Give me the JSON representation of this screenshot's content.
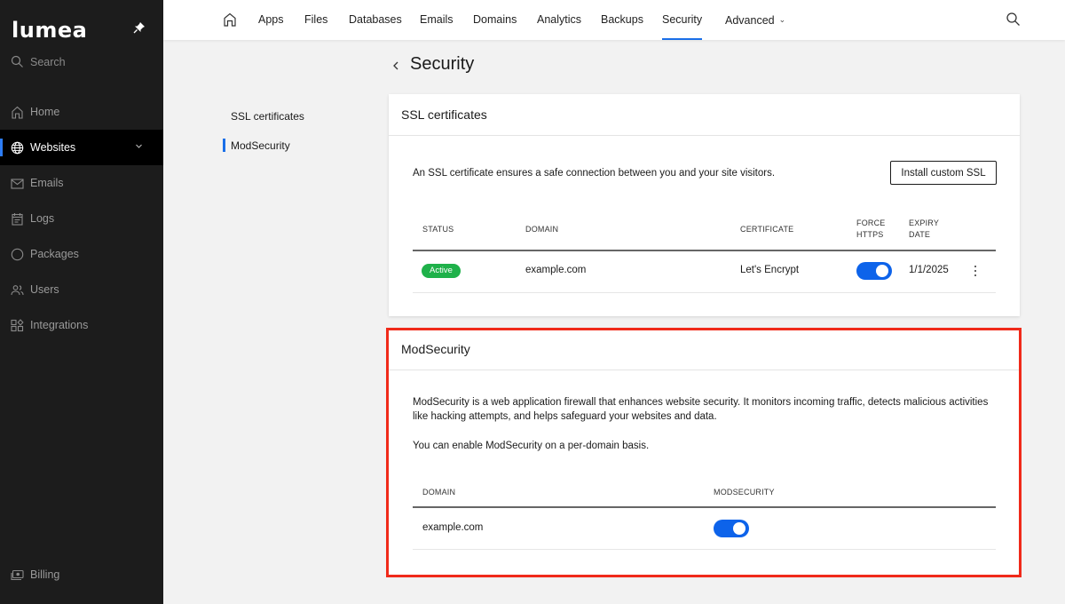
{
  "sidebar": {
    "logo": "lumea",
    "search_label": "Search",
    "items": [
      {
        "label": "Home",
        "icon": "home-icon",
        "active": false
      },
      {
        "label": "Websites",
        "icon": "globe-icon",
        "active": true
      },
      {
        "label": "Emails",
        "icon": "mail-icon",
        "active": false
      },
      {
        "label": "Logs",
        "icon": "calendar-log-icon",
        "active": false
      },
      {
        "label": "Packages",
        "icon": "circle-icon",
        "active": false
      },
      {
        "label": "Users",
        "icon": "users-icon",
        "active": false
      },
      {
        "label": "Integrations",
        "icon": "grid-icon",
        "active": false
      }
    ],
    "billing_label": "Billing"
  },
  "topnav": {
    "items": [
      {
        "label": "Apps"
      },
      {
        "label": "Files"
      },
      {
        "label": "Databases"
      },
      {
        "label": "Emails"
      },
      {
        "label": "Domains"
      },
      {
        "label": "Analytics"
      },
      {
        "label": "Backups"
      },
      {
        "label": "Security",
        "active": true
      },
      {
        "label": "Advanced",
        "has_dropdown": true
      }
    ]
  },
  "page": {
    "title": "Security",
    "subnav": [
      {
        "label": "SSL certificates",
        "active": false
      },
      {
        "label": "ModSecurity",
        "active": true
      }
    ]
  },
  "ssl": {
    "title": "SSL certificates",
    "description": "An SSL certificate ensures a safe connection between you and your site visitors.",
    "install_button": "Install custom SSL",
    "headers": {
      "status": "Status",
      "domain": "Domain",
      "certificate": "Certificate",
      "force_https_1": "Force",
      "force_https_2": "HTTPS",
      "expiry_1": "Expiry",
      "expiry_2": "Date"
    },
    "rows": [
      {
        "status": "Active",
        "domain": "example.com",
        "certificate": "Let's Encrypt",
        "force_https": true,
        "expiry": "1/1/2025"
      }
    ]
  },
  "modsecurity": {
    "title": "ModSecurity",
    "description_1": "ModSecurity is a web application firewall that enhances website security. It monitors incoming traffic, detects malicious activities",
    "description_2": "like hacking attempts, and helps safeguard your websites and data.",
    "description_3": "You can enable ModSecurity on a per-domain basis.",
    "headers": {
      "domain": "Domain",
      "modsecurity": "ModSecurity"
    },
    "rows": [
      {
        "domain": "example.com",
        "enabled": true
      }
    ]
  },
  "colors": {
    "accent": "#1a6fe8",
    "toggle_on": "#0d63ea",
    "active_badge": "#1fb14a",
    "highlight": "#f02a1a",
    "sidebar_bg": "#1c1c1c"
  }
}
